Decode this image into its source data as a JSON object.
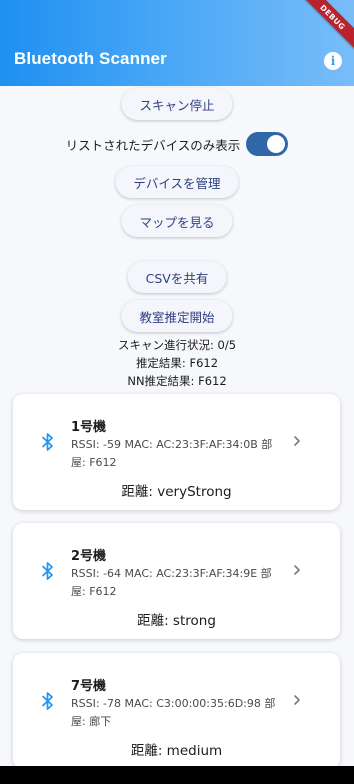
{
  "app_bar": {
    "title": "Bluetooth Scanner",
    "info_icon": "info-icon",
    "debug_banner": "DEBUG",
    "colors": {
      "gradient_start": "#1e90f0",
      "gradient_end": "#79bdf8"
    }
  },
  "controls": {
    "stop_scan_label": "スキャン停止",
    "listed_only_label": "リストされたデバイスのみ表示",
    "listed_only_enabled": true,
    "manage_devices_label": "デバイスを管理",
    "view_map_label": "マップを見る",
    "share_csv_label": "CSVを共有",
    "start_room_estimation_label": "教室推定開始"
  },
  "status": {
    "scan_progress": "スキャン進行状況: 0/5",
    "estimation_result": "推定結果: F612",
    "nn_estimation_result": "NN推定結果: F612"
  },
  "devices": [
    {
      "name": "1号機",
      "info": "RSSI: -59  MAC: AC:23:3F:AF:34:0B 部屋: F612",
      "distance": "距離: veryStrong",
      "icon": "bluetooth-icon"
    },
    {
      "name": "2号機",
      "info": "RSSI: -64  MAC: AC:23:3F:AF:34:9E 部屋: F612",
      "distance": "距離: strong",
      "icon": "bluetooth-icon"
    },
    {
      "name": "7号機",
      "info": "RSSI: -78  MAC: C3:00:00:35:6D:98 部屋: 廊下",
      "distance": "距離: medium",
      "icon": "bluetooth-icon"
    }
  ],
  "theme": {
    "accent": "#2f67a9",
    "button_text": "#2f3f82",
    "bluetooth_blue": "#2196f3"
  }
}
